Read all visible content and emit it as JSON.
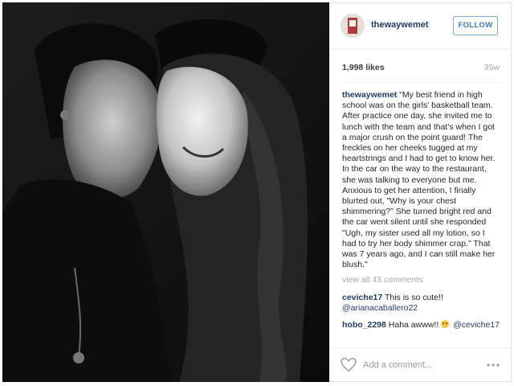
{
  "post": {
    "username": "thewaywemet",
    "follow_label": "FOLLOW",
    "likes": "1,998 likes",
    "age": "35w"
  },
  "caption": {
    "username": "thewaywemet",
    "text": "\"My best friend in high school was on the girls' basketball team. After practice one day, she invited me to lunch with the team and that's when I got a major crush on the point guard! The freckles on her cheeks tugged at my heartstrings and I had to get to know her. In the car on the way to the restaurant, she was talking to everyone but me. Anxious to get her attention, I finally blurted out, \"Why is your chest shimmering?\" She turned bright red and the car went silent until she responded \"Ugh, my sister used all my lotion, so I had to try her body shimmer crap.\" That was 7 years ago, and I can still make her blush.\""
  },
  "view_all": "view all 43 comments",
  "comments": [
    {
      "username": "ceviche17",
      "text": "This is so cute!!",
      "mention": "@arianacaballero22"
    },
    {
      "username": "hobo_2298",
      "text": "Haha awww!!",
      "emoji": "smile-emoji",
      "mention": "@ceviche17"
    }
  ],
  "footer": {
    "add_comment_placeholder": "Add a comment...",
    "icons": [
      "heart-icon",
      "more-options-icon"
    ]
  },
  "colors": {
    "username": "#1f3b5e",
    "follow_border": "#7ea6cf",
    "follow_text": "#3f78b4",
    "muted": "#a8a8a8"
  }
}
